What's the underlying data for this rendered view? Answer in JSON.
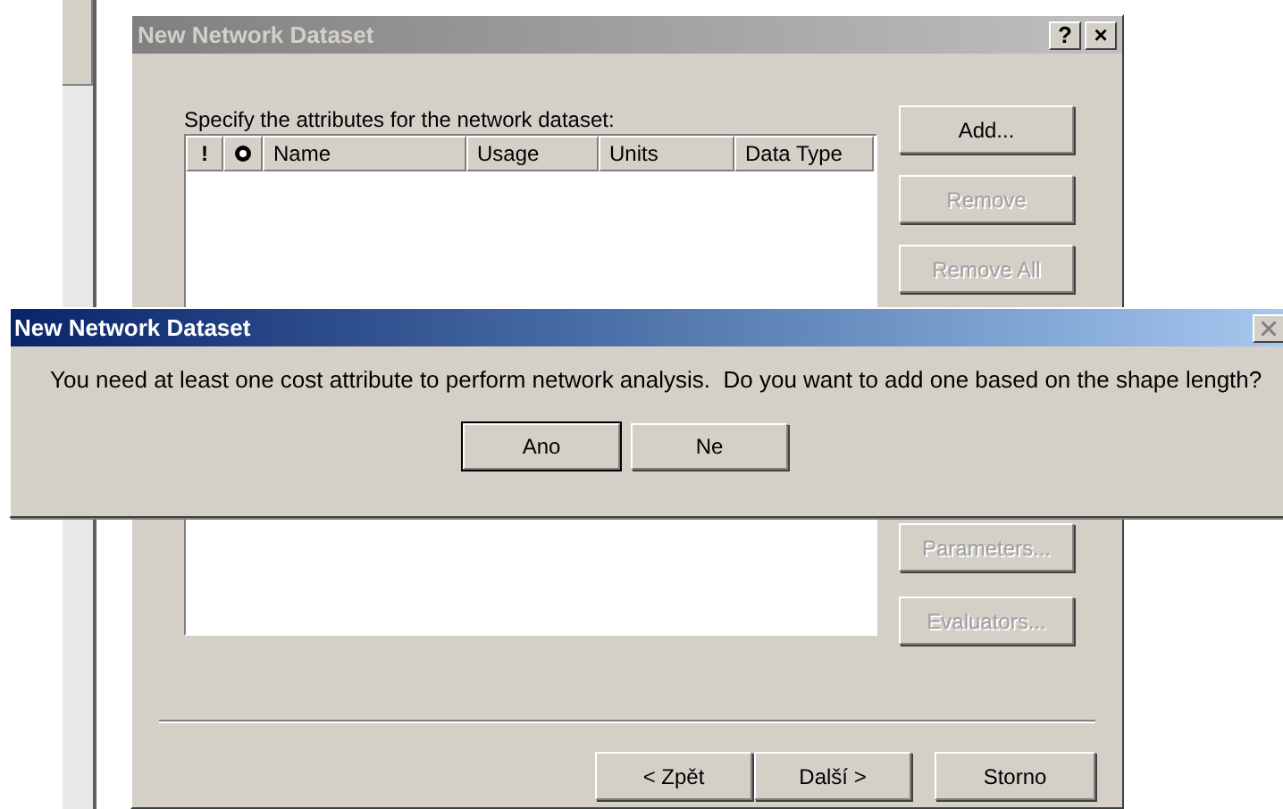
{
  "back_window": {
    "title": "New Network Dataset",
    "active": false,
    "title_buttons": [
      "?",
      "×"
    ],
    "prompt": "Specify the attributes for the network dataset:",
    "columns": [
      {
        "kind": "text",
        "label": "!"
      },
      {
        "kind": "icon"
      },
      {
        "kind": "text",
        "label": "Name"
      },
      {
        "kind": "text",
        "label": "Usage"
      },
      {
        "kind": "text",
        "label": "Units"
      },
      {
        "kind": "text",
        "label": "Data Type"
      }
    ],
    "side_buttons_top": [
      {
        "label": "Add...",
        "disabled": false
      },
      {
        "label": "Remove",
        "disabled": true
      },
      {
        "label": "Remove All",
        "disabled": true
      }
    ],
    "side_buttons_bottom": [
      {
        "label": "Parameters...",
        "disabled": true
      },
      {
        "label": "Evaluators...",
        "disabled": true
      }
    ],
    "nav_buttons": [
      {
        "label": "< Zpět"
      },
      {
        "label": "Další >"
      }
    ],
    "cancel_button": "Storno"
  },
  "message_box": {
    "title": "New Network Dataset",
    "active": true,
    "message": "You need at least one cost attribute to perform network analysis.  Do you want to add one based on the shape length?",
    "buttons": [
      {
        "label": "Ano",
        "default": true
      },
      {
        "label": "Ne",
        "default": false
      }
    ]
  }
}
